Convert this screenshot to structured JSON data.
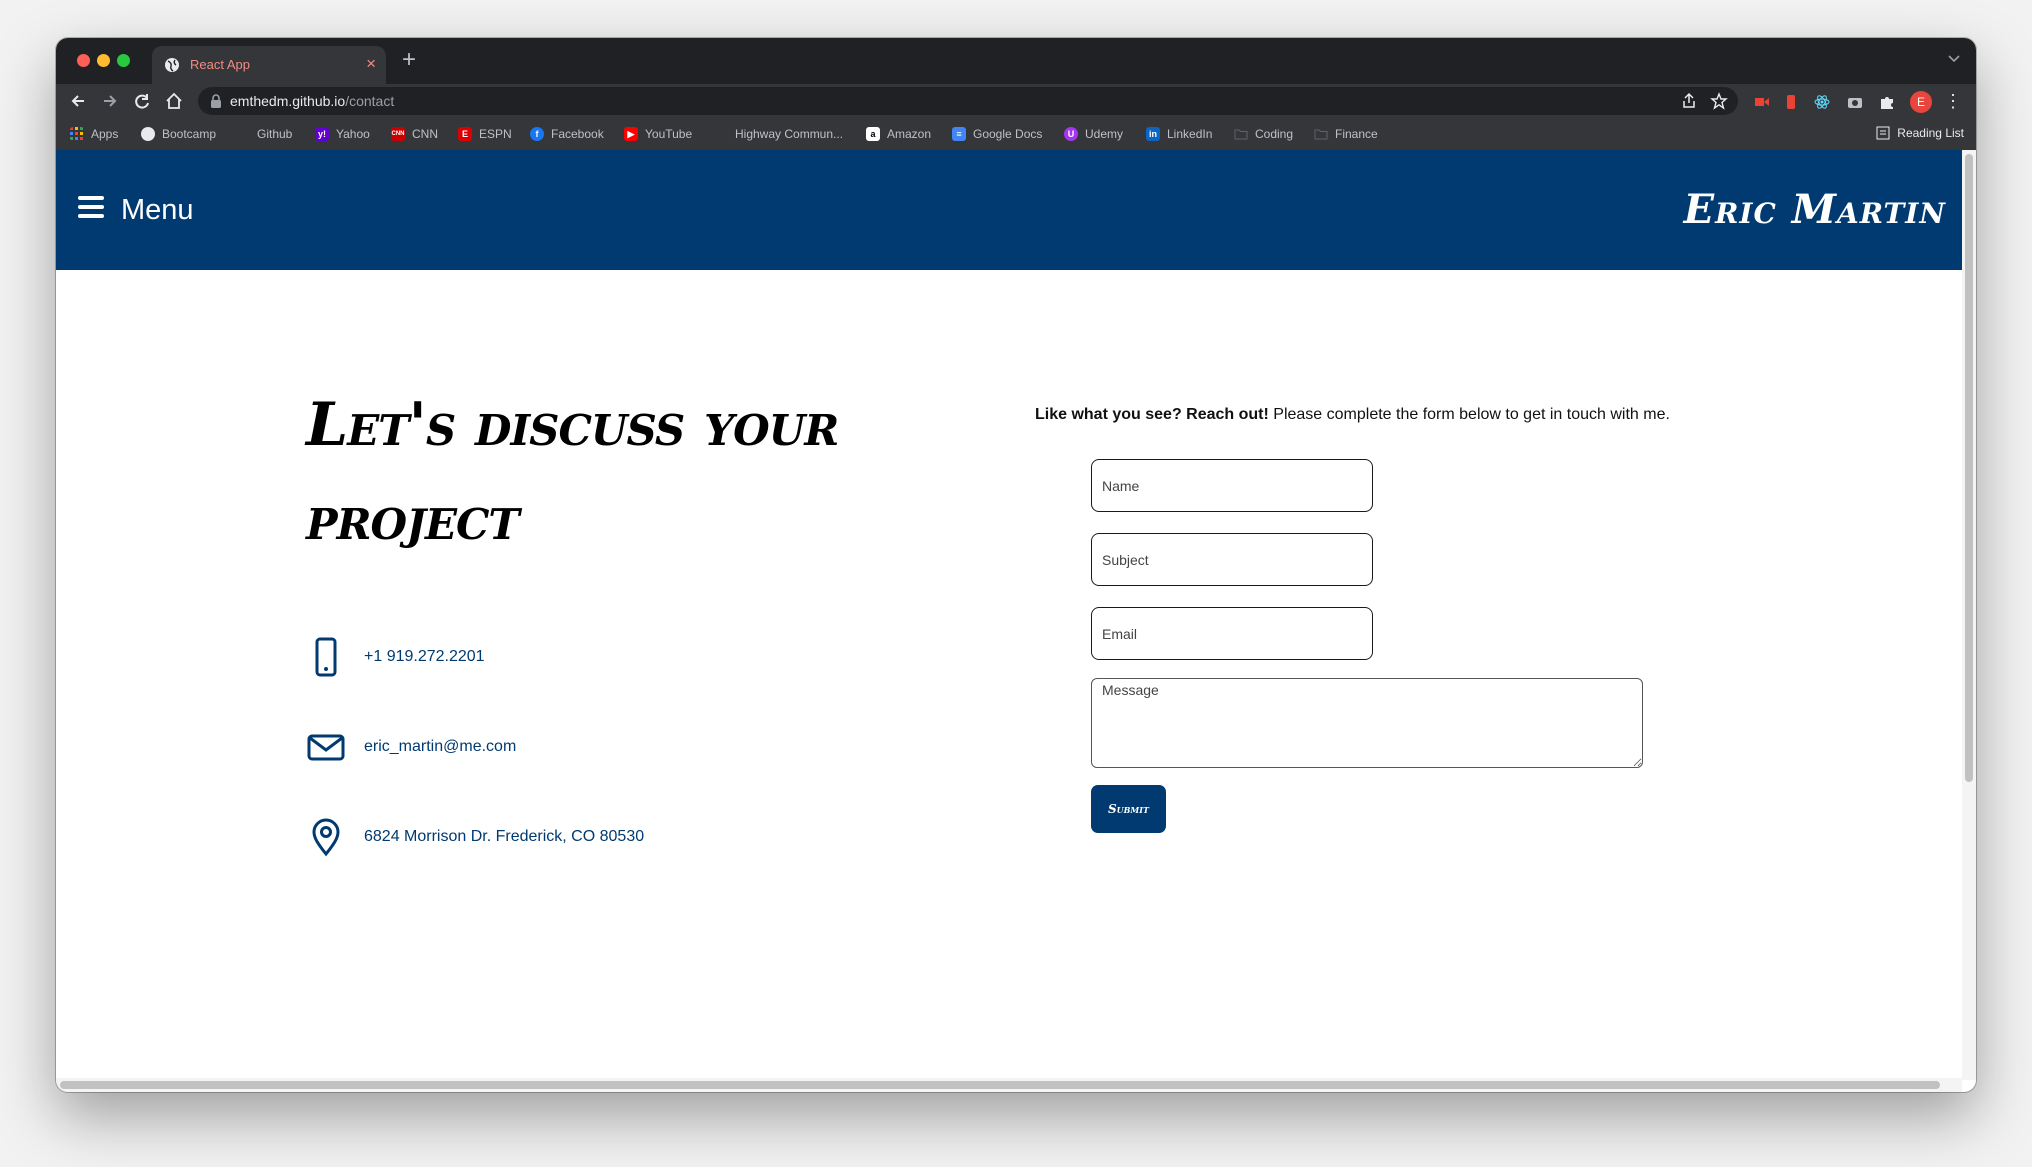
{
  "browser": {
    "tab_title": "React App",
    "tab_close": "×",
    "new_tab": "+",
    "url_host": "emthedm.github.io",
    "url_path": "/contact",
    "avatar_letter": "E",
    "menu_glyph": "⋮",
    "bookmarks": [
      {
        "label": "Apps",
        "icon": "apps-grid-icon",
        "color": "#ea4335"
      },
      {
        "label": "Bootcamp",
        "icon": "globe-icon",
        "color": "#bdc1c6"
      },
      {
        "label": "Github",
        "icon": "github-icon",
        "color": "#35363a"
      },
      {
        "label": "Yahoo",
        "icon": "yahoo-icon",
        "color": "#6001d2"
      },
      {
        "label": "CNN",
        "icon": "cnn-icon",
        "color": "#cc0000"
      },
      {
        "label": "ESPN",
        "icon": "espn-icon",
        "color": "#d00"
      },
      {
        "label": "Facebook",
        "icon": "facebook-icon",
        "color": "#1877f2"
      },
      {
        "label": "YouTube",
        "icon": "youtube-icon",
        "color": "#ff0000"
      },
      {
        "label": "Highway Commun...",
        "icon": "highway-icon",
        "color": "#35363a"
      },
      {
        "label": "Amazon",
        "icon": "amazon-icon",
        "color": "#ffffff"
      },
      {
        "label": "Google Docs",
        "icon": "google-docs-icon",
        "color": "#4285f4"
      },
      {
        "label": "Udemy",
        "icon": "udemy-icon",
        "color": "#a435f0"
      },
      {
        "label": "LinkedIn",
        "icon": "linkedin-icon",
        "color": "#0a66c2"
      },
      {
        "label": "Coding",
        "icon": "folder-icon",
        "color": "#5f6368"
      },
      {
        "label": "Finance",
        "icon": "folder-icon",
        "color": "#5f6368"
      }
    ],
    "reading_list": "Reading List"
  },
  "header": {
    "menu_label": "Menu",
    "brand": "Eric Martin"
  },
  "contact": {
    "headline": "Let's discuss your project",
    "phone": "+1 919.272.2201",
    "email": "eric_martin@me.com",
    "address": "6824 Morrison Dr. Frederick, CO 80530"
  },
  "form": {
    "intro_bold": "Like what you see? Reach out!",
    "intro_rest": " Please complete the form below to get in touch with me.",
    "name_placeholder": "Name",
    "subject_placeholder": "Subject",
    "email_placeholder": "Email",
    "message_placeholder": "Message",
    "submit_label": "Submit"
  },
  "colors": {
    "brand_navy": "#003a70",
    "chrome_dark": "#202124",
    "chrome_toolbar": "#35363a"
  }
}
